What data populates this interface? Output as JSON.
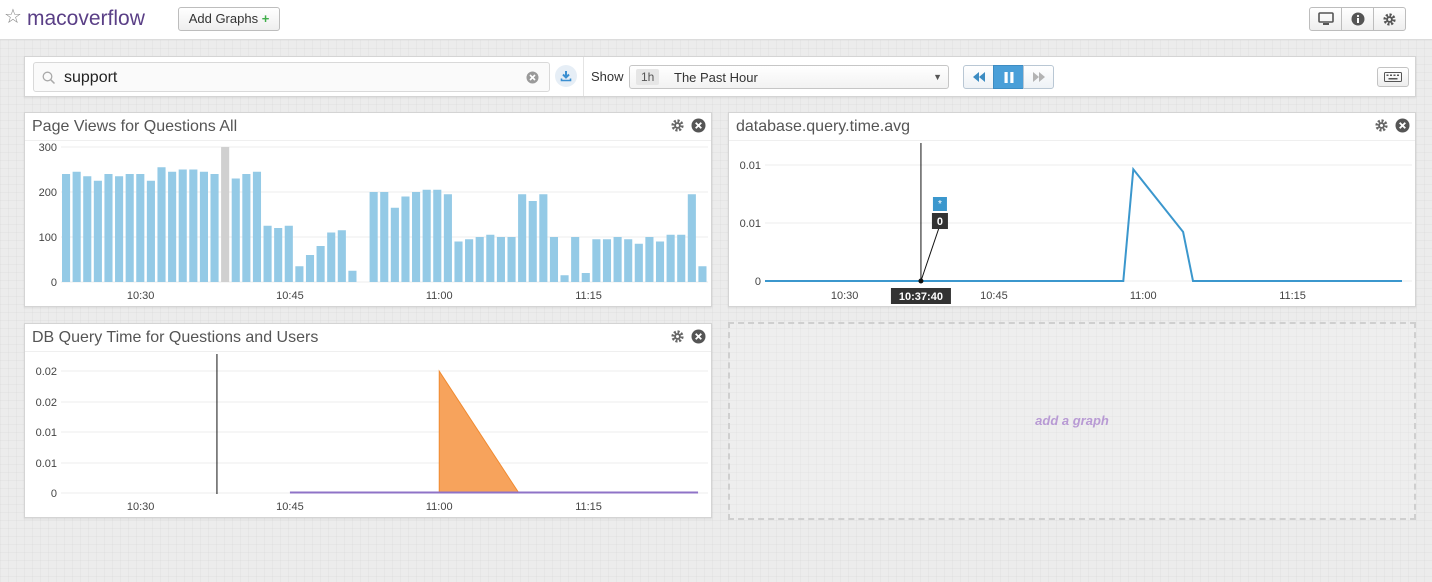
{
  "header": {
    "dashboard_title": "macoverflow",
    "add_graphs_label": "Add Graphs",
    "add_graphs_plus": "+",
    "icons": [
      "star-icon",
      "monitor-icon",
      "info-icon",
      "gear-icon"
    ]
  },
  "search": {
    "value": "support",
    "icons": [
      "search-icon",
      "clear-icon",
      "download-icon"
    ]
  },
  "timeframe": {
    "show_label": "Show",
    "badge": "1h",
    "selected": "The Past Hour",
    "controls": [
      "rewind-icon",
      "pause-icon",
      "fast-forward-icon",
      "keyboard-icon"
    ]
  },
  "graphs": {
    "page_views": {
      "title": "Page Views for Questions All"
    },
    "db_avg": {
      "title": "database.query.time.avg",
      "marker_star": "*",
      "marker_value": "0",
      "cursor_time": "10:37:40"
    },
    "db_query": {
      "title": "DB Query Time for Questions and Users"
    },
    "add_graph_label": "add a graph"
  },
  "colors": {
    "bar": "#94cae6",
    "bar_highlight": "#d0d0d0",
    "line_blue": "#3b97cd",
    "area_orange": "#f7a35c",
    "line_purple": "#8f73c7",
    "title_purple": "#5a3f86"
  },
  "chart_data": [
    {
      "type": "bar",
      "title": "Page Views for Questions All",
      "yticks": [
        "0",
        "100",
        "200",
        "300"
      ],
      "ylim": [
        0,
        300
      ],
      "xticks": [
        "10:30",
        "10:45",
        "11:00",
        "11:15"
      ],
      "highlight_index": 15,
      "values": [
        240,
        245,
        235,
        225,
        240,
        235,
        240,
        240,
        225,
        255,
        245,
        250,
        250,
        245,
        240,
        310,
        230,
        240,
        245,
        125,
        120,
        125,
        35,
        60,
        80,
        110,
        115,
        25,
        0,
        200,
        200,
        165,
        190,
        200,
        205,
        205,
        195,
        90,
        95,
        100,
        105,
        100,
        100,
        195,
        180,
        195,
        100,
        15,
        100,
        20,
        95,
        95,
        100,
        95,
        85,
        100,
        90,
        105,
        105,
        195,
        35
      ],
      "grid": true
    },
    {
      "type": "line",
      "title": "database.query.time.avg",
      "yticks": [
        "0",
        "0.01",
        "0.01"
      ],
      "xticks": [
        "10:30",
        "10:45",
        "11:00",
        "11:15"
      ],
      "series": [
        {
          "x": [
            "10:22",
            "10:37",
            "10:52",
            "10:58",
            "10:59",
            "11:04",
            "11:05",
            "11:26"
          ],
          "values": [
            0.0,
            0.0,
            0.0,
            0.0,
            0.0125,
            0.0055,
            0.0,
            0.0
          ]
        }
      ],
      "grid": true
    },
    {
      "type": "area",
      "title": "DB Query Time for Questions and Users",
      "yticks": [
        "0",
        "0.01",
        "0.01",
        "0.02",
        "0.02"
      ],
      "xticks": [
        "10:30",
        "10:45",
        "11:00",
        "11:15"
      ],
      "series": [
        {
          "x": [
            "11:00",
            "11:08"
          ],
          "values": [
            0.025,
            0.0
          ]
        },
        {
          "x": [
            "10:45",
            "11:26"
          ],
          "values": [
            0.0,
            0.0
          ]
        }
      ],
      "grid": true
    }
  ]
}
